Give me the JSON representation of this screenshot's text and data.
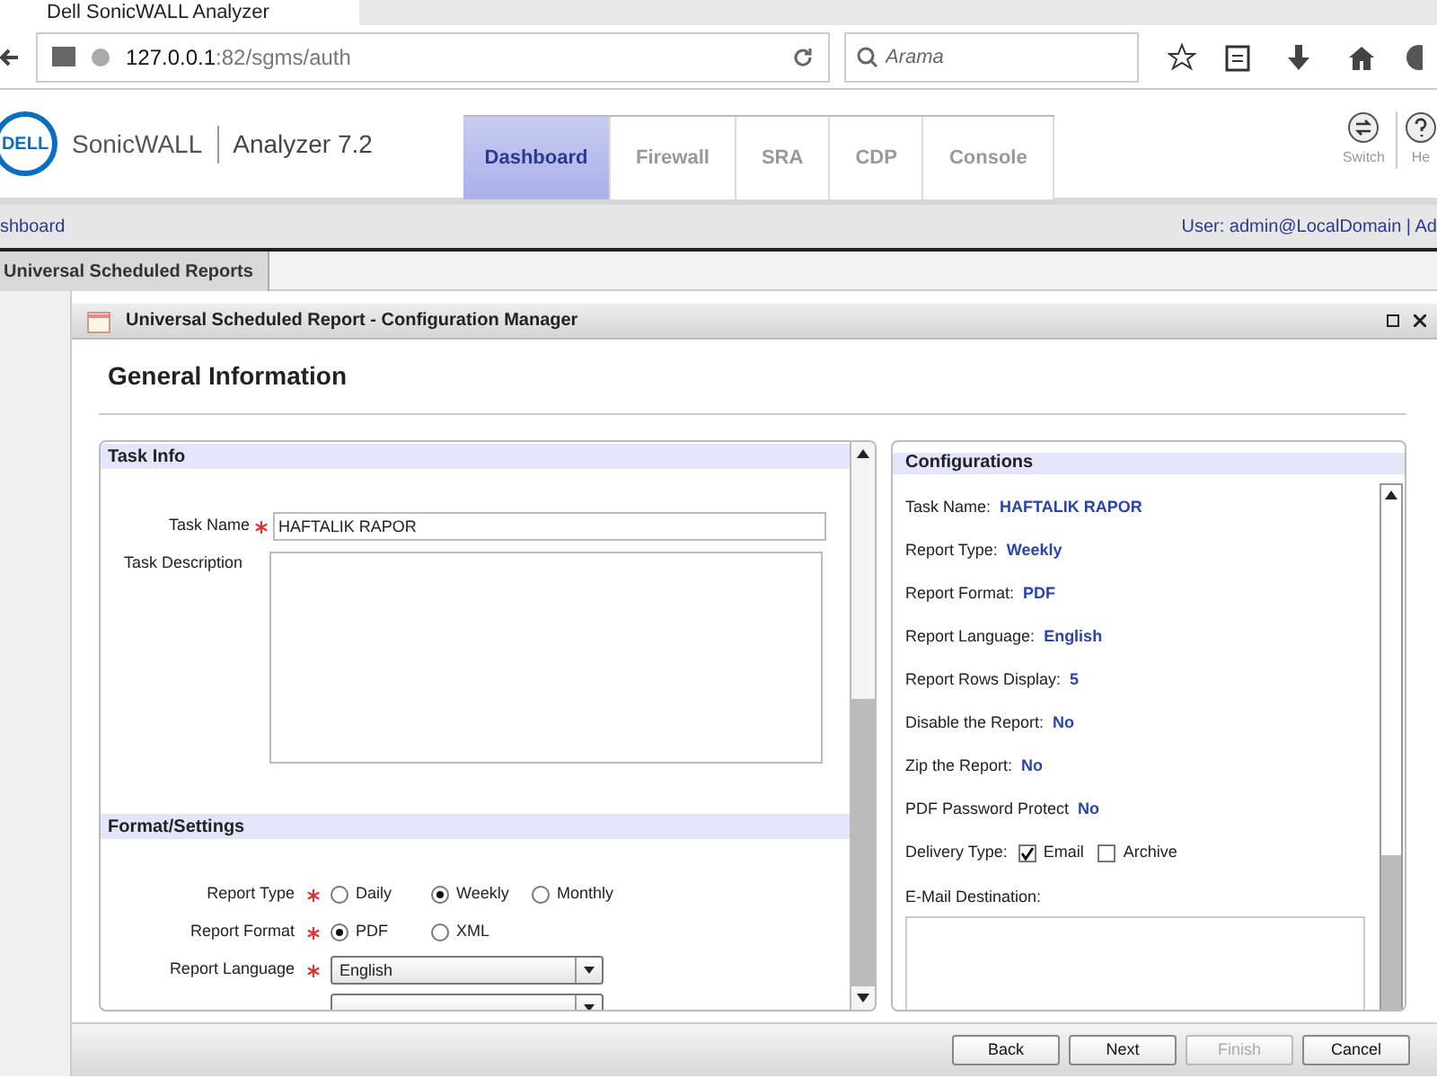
{
  "browser": {
    "tab_title": "Dell SonicWALL Analyzer",
    "url_host": "127.0.0.1",
    "url_path": ":82/sgms/auth",
    "search_placeholder": "Arama"
  },
  "app": {
    "logo": "DELL",
    "brand": "SonicWALL",
    "product": "Analyzer 7.2",
    "tabs": [
      {
        "label": "Dashboard",
        "selected": true
      },
      {
        "label": "Firewall",
        "selected": false
      },
      {
        "label": "SRA",
        "selected": false
      },
      {
        "label": "CDP",
        "selected": false
      },
      {
        "label": "Console",
        "selected": false
      }
    ],
    "tools": [
      {
        "kind": "switch",
        "label": "Switch"
      },
      {
        "kind": "help",
        "label": "He"
      }
    ]
  },
  "breadcrumb": "shboard",
  "user_info": "User: admin@LocalDomain | Ad",
  "page_tabs": [
    {
      "label": "Universal Scheduled Reports",
      "selected": true
    }
  ],
  "dialog": {
    "title": "Universal Scheduled Report - Configuration Manager",
    "heading": "General Information",
    "task_info": {
      "title": "Task Info",
      "task_name": {
        "label": "Task Name",
        "required": true,
        "value": "HAFTALIK RAPOR"
      },
      "task_description": {
        "label": "Task Description"
      }
    },
    "format_settings": {
      "title": "Format/Settings",
      "rows": [
        {
          "kind": "radio",
          "label": "Report Type",
          "required": true,
          "options": [
            {
              "label": "Daily",
              "selected": false
            },
            {
              "label": "Weekly",
              "selected": true
            },
            {
              "label": "Monthly",
              "selected": false
            }
          ]
        },
        {
          "kind": "radio",
          "label": "Report Format",
          "required": true,
          "options": [
            {
              "label": "PDF",
              "selected": true
            },
            {
              "label": "XML",
              "selected": false
            }
          ]
        },
        {
          "kind": "select",
          "label": "Report Language",
          "required": true,
          "value": "English"
        },
        {
          "kind": "select"
        }
      ]
    },
    "configurations": {
      "title": "Configurations",
      "items": [
        {
          "label": "Task Name:",
          "value": "HAFTALIK RAPOR"
        },
        {
          "label": "Report Type:",
          "value": "Weekly"
        },
        {
          "label": "Report Format:",
          "value": "PDF"
        },
        {
          "label": "Report Language:",
          "value": "English"
        },
        {
          "label": "Report Rows Display:",
          "value": "5"
        },
        {
          "label": "Disable the Report:",
          "value": "No"
        },
        {
          "label": "Zip the Report:",
          "value": "No"
        },
        {
          "label": "PDF Password Protect",
          "value": "No"
        }
      ],
      "delivery": {
        "label": "Delivery Type:",
        "options": [
          {
            "label": "Email",
            "checked": true
          },
          {
            "label": "Archive",
            "checked": false
          }
        ]
      },
      "email_destination": {
        "label": "E-Mail Destination:"
      }
    },
    "buttons": [
      {
        "label": "Back",
        "disabled": false
      },
      {
        "label": "Next",
        "disabled": false
      },
      {
        "label": "Finish",
        "disabled": true
      },
      {
        "label": "Cancel",
        "disabled": false
      }
    ]
  }
}
